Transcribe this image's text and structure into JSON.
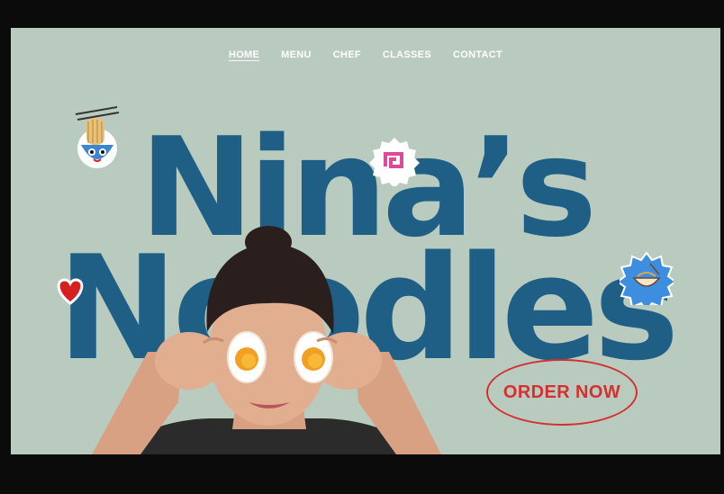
{
  "nav": {
    "items": [
      {
        "label": "HOME",
        "active": true
      },
      {
        "label": "MENU",
        "active": false
      },
      {
        "label": "CHEF",
        "active": false
      },
      {
        "label": "CLASSES",
        "active": false
      },
      {
        "label": "CONTACT",
        "active": false
      }
    ]
  },
  "hero": {
    "line1": "Nina’s",
    "line2": "Noodles"
  },
  "cta": {
    "label": "ORDER NOW"
  },
  "colors": {
    "background": "#b9cbbf",
    "title": "#1f5f86",
    "accent": "#d62f2f",
    "nav": "#ffffff"
  },
  "stickers": [
    "noodle-bowl-icon",
    "naruto-fishcake-icon",
    "heart-icon",
    "ramen-bowl-badge-icon"
  ]
}
